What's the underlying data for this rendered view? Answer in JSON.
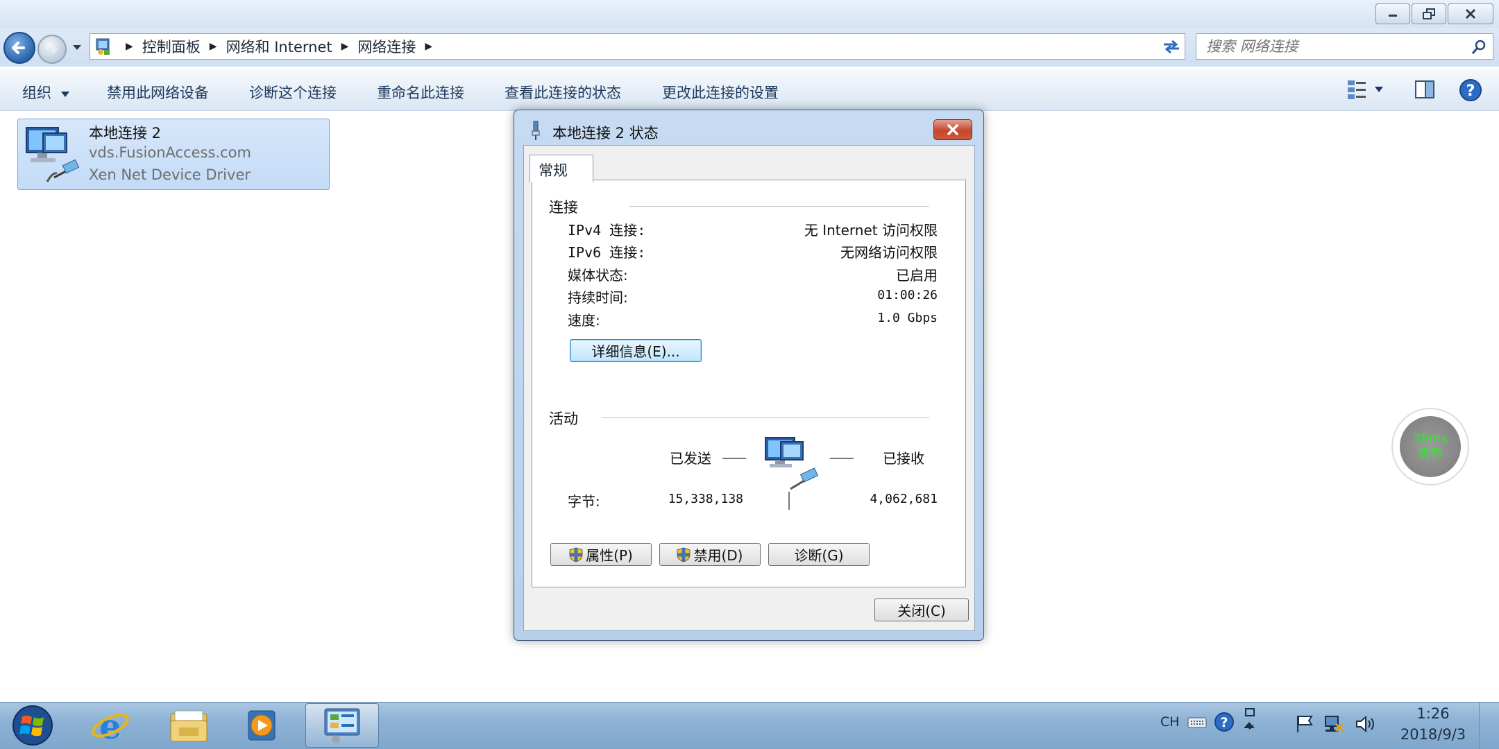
{
  "window": {
    "breadcrumb": [
      "控制面板",
      "网络和 Internet",
      "网络连接"
    ],
    "search_placeholder": "搜索 网络连接"
  },
  "commandbar": {
    "organize": "组织",
    "disable": "禁用此网络设备",
    "diagnose": "诊断这个连接",
    "rename": "重命名此连接",
    "view_status": "查看此连接的状态",
    "change_settings": "更改此连接的设置"
  },
  "connection_item": {
    "name": "本地连接 2",
    "network": "vds.FusionAccess.com",
    "driver": "Xen Net Device Driver"
  },
  "dialog": {
    "title": "本地连接 2 状态",
    "tab": "常规",
    "connection_group": "连接",
    "ipv4_label": "IPv4 连接:",
    "ipv4_value": "无 Internet 访问权限",
    "ipv6_label": "IPv6 连接:",
    "ipv6_value": "无网络访问权限",
    "media_label": "媒体状态:",
    "media_value": "已启用",
    "duration_label": "持续时间:",
    "duration_value": "01:00:26",
    "speed_label": "速度:",
    "speed_value": "1.0 Gbps",
    "details_button": "详细信息(E)...",
    "activity_group": "活动",
    "sent_label": "已发送",
    "received_label": "已接收",
    "bytes_label": "字节:",
    "bytes_sent": "15,338,138",
    "bytes_received": "4,062,681",
    "properties_button": "属性(P)",
    "disable_button": "禁用(D)",
    "diagnose_button": "诊断(G)",
    "close_button": "关闭(C)"
  },
  "ping_widget": {
    "latency": "38ms",
    "quality": "优秀"
  },
  "taskbar": {
    "lang": "CH",
    "time": "1:26",
    "date": "2018/9/3"
  }
}
